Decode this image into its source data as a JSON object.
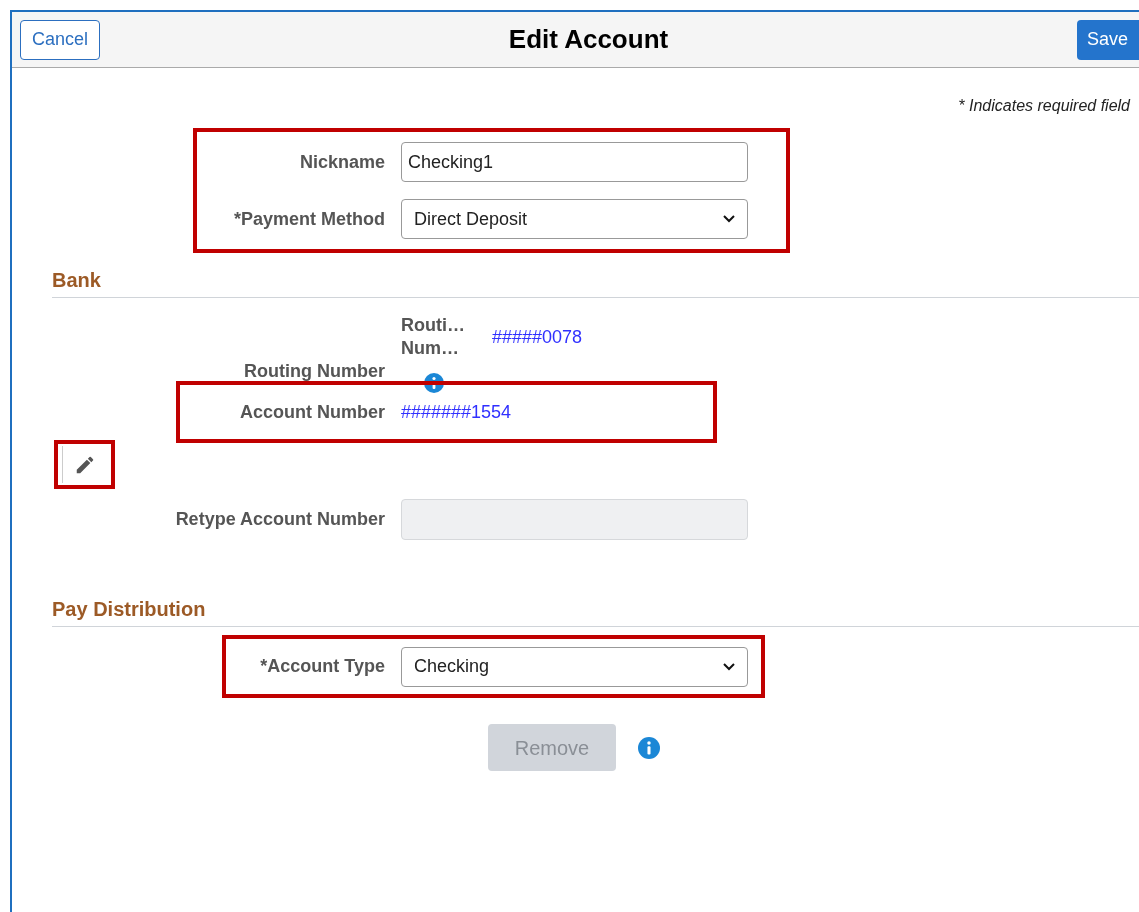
{
  "header": {
    "cancel": "Cancel",
    "title": "Edit Account",
    "save": "Save"
  },
  "required_note": "* Indicates required field",
  "account_fields": {
    "highlighted": true,
    "fields": [
      {
        "label": "Nickname",
        "kind": "text",
        "value": "Checking1"
      },
      {
        "label": "*Payment Method",
        "kind": "select",
        "value": "Direct Deposit"
      }
    ]
  },
  "bank": {
    "title": "Bank",
    "routing": {
      "label": "Routing Number",
      "sub_label": [
        "Routi…",
        "Num…"
      ],
      "value": "#####0078"
    },
    "account_number": {
      "label": "Account Number",
      "value": "#######1554",
      "highlighted": true
    },
    "edit_highlighted": true,
    "retype": {
      "label": "Retype Account Number",
      "disabled": true
    }
  },
  "pay_distribution": {
    "title": "Pay Distribution",
    "account_type": {
      "label": "*Account Type",
      "value": "Checking",
      "highlighted": true
    },
    "remove": {
      "label": "Remove",
      "disabled": true
    }
  }
}
